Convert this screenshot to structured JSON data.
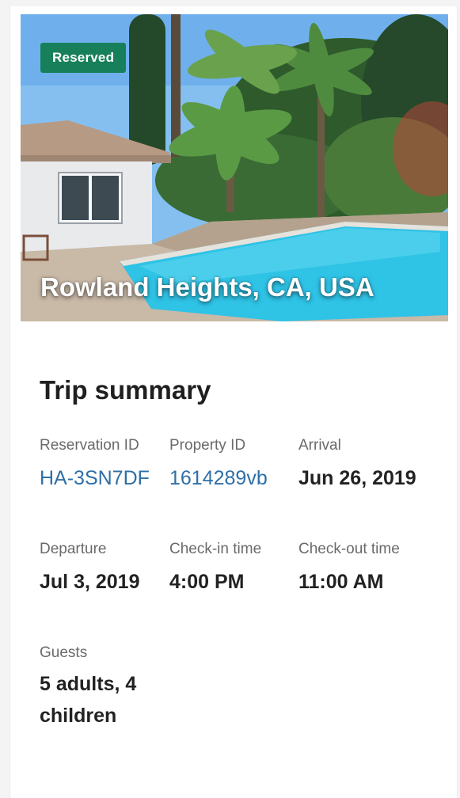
{
  "hero": {
    "badge": "Reserved",
    "location": "Rowland Heights, CA, USA"
  },
  "summary": {
    "title": "Trip summary",
    "fields": [
      {
        "label": "Reservation ID",
        "value": "HA-3SN7DF",
        "is_link": true
      },
      {
        "label": "Property ID",
        "value": "1614289vb",
        "is_link": true
      },
      {
        "label": "Arrival",
        "value": "Jun 26, 2019",
        "is_link": false
      },
      {
        "label": "Departure",
        "value": "Jul 3, 2019",
        "is_link": false
      },
      {
        "label": "Check-in time",
        "value": "4:00 PM",
        "is_link": false
      },
      {
        "label": "Check-out time",
        "value": "11:00 AM",
        "is_link": false
      },
      {
        "label": "Guests",
        "value": "5 adults, 4 children",
        "is_link": false
      }
    ]
  },
  "colors": {
    "badge": "#17805a",
    "link": "#2f6fa8",
    "pool": "#2fc3e6"
  }
}
